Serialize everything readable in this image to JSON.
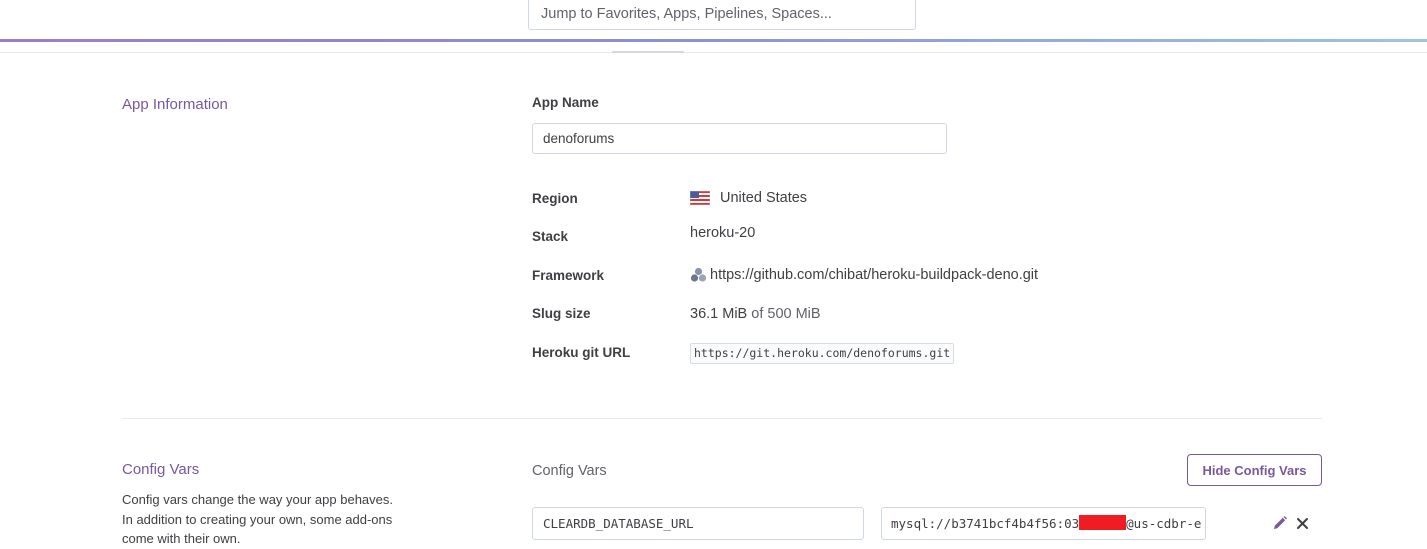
{
  "header": {
    "search": {
      "placeholder": "Jump to Favorites, Apps, Pipelines, Spaces..."
    }
  },
  "app_information": {
    "section_title": "App Information",
    "app_name_label": "App Name",
    "app_name_value": "denoforums",
    "rows": {
      "region": {
        "label": "Region",
        "value": "United States",
        "flag_icon": "us-flag-icon"
      },
      "stack": {
        "label": "Stack",
        "value": "heroku-20"
      },
      "framework": {
        "label": "Framework",
        "value": "https://github.com/chibat/heroku-buildpack-deno.git",
        "icon": "buildpack-icon"
      },
      "slug_size": {
        "label": "Slug size",
        "value": "36.1 MiB",
        "suffix": "of 500 MiB"
      },
      "git_url": {
        "label": "Heroku git URL",
        "value": "https://git.heroku.com/denoforums.git"
      }
    }
  },
  "config_vars": {
    "section_title": "Config Vars",
    "description": "Config vars change the way your app behaves. In addition to creating your own, some add-ons come with their own.",
    "list_label": "Config Vars",
    "hide_button_label": "Hide Config Vars",
    "vars": [
      {
        "key": "CLEARDB_DATABASE_URL",
        "value_start": "mysql://b3741bcf4b4f56:03",
        "value_end": "@us-cdbr-e"
      }
    ],
    "edit_icon": "pencil-icon",
    "delete_icon": "close-icon"
  },
  "colors": {
    "accent": "#79589f",
    "text": "#3f3f44",
    "border": "#cfd7e6",
    "redaction": "#ef1c24"
  }
}
